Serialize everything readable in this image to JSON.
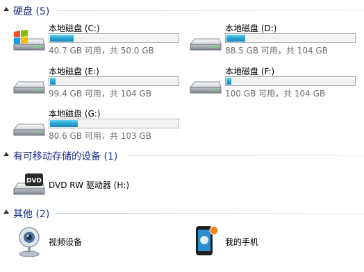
{
  "groups": {
    "hard_drives": {
      "title": "硬盘 (5)"
    },
    "removable": {
      "title": "有可移动存储的设备 (1)"
    },
    "other": {
      "title": "其他 (2)"
    }
  },
  "drives": [
    {
      "name": "本地磁盘 (C:)",
      "free_text": "40.7 GB 可用，共 50.0 GB",
      "used_fraction": 0.186
    },
    {
      "name": "本地磁盘 (D:)",
      "free_text": "88.5 GB 可用，共 104 GB",
      "used_fraction": 0.149
    },
    {
      "name": "本地磁盘 (E:)",
      "free_text": "99.4 GB 可用，共 104 GB",
      "used_fraction": 0.044
    },
    {
      "name": "本地磁盘 (F:)",
      "free_text": "100 GB 可用，共 104 GB",
      "used_fraction": 0.038
    },
    {
      "name": "本地磁盘 (G:)",
      "free_text": "80.6 GB 可用，共 103 GB",
      "used_fraction": 0.217
    }
  ],
  "removable_devices": [
    {
      "name": "DVD RW 驱动器 (H:)",
      "icon": "dvd-drive-icon"
    }
  ],
  "other_devices": [
    {
      "name": "视频设备",
      "icon": "webcam-icon"
    },
    {
      "name": "我的手机",
      "icon": "smartphone-icon"
    }
  ],
  "colors": {
    "group_title": "#1e3287",
    "bar_fill": "#27a5d2",
    "free_text": "#6d6d6d"
  }
}
